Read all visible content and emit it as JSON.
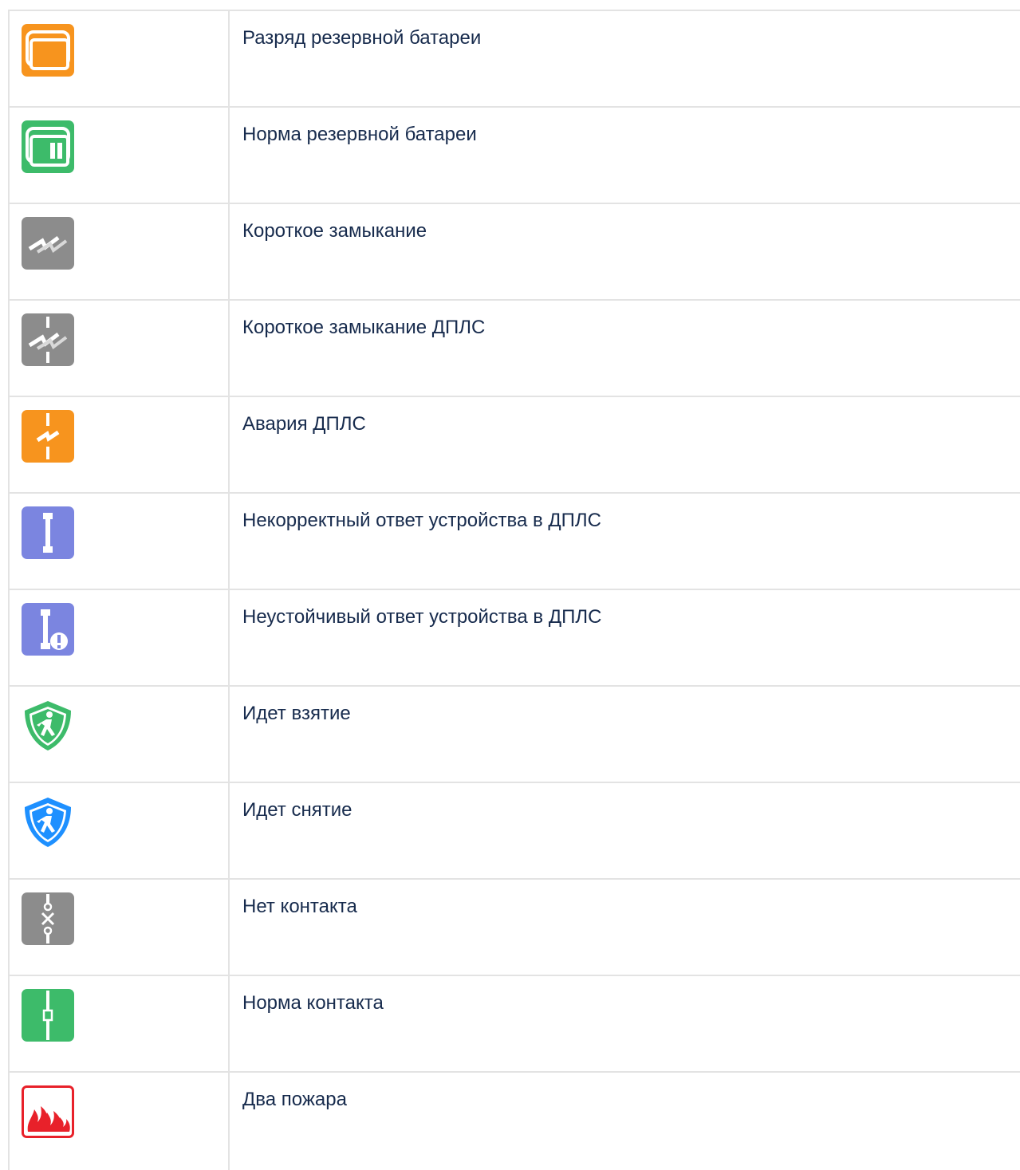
{
  "rows": [
    {
      "icon": "battery-discharge-icon",
      "label": "Разряд резервной батареи",
      "color": "#f7941e"
    },
    {
      "icon": "battery-normal-icon",
      "label": "Норма резервной батареи",
      "color": "#3dbb6a"
    },
    {
      "icon": "short-circuit-icon",
      "label": "Короткое замыкание",
      "color": "#8c8c8c"
    },
    {
      "icon": "short-circuit-dpls-icon",
      "label": "Короткое замыкание ДПЛС",
      "color": "#8c8c8c"
    },
    {
      "icon": "dpls-failure-icon",
      "label": "Авария ДПЛС",
      "color": "#f7941e"
    },
    {
      "icon": "device-invalid-response-icon",
      "label": "Некорректный ответ устройства в ДПЛС",
      "color": "#7b85e0"
    },
    {
      "icon": "device-unstable-response-icon",
      "label": "Неустойчивый ответ устройства в ДПЛС",
      "color": "#7b85e0"
    },
    {
      "icon": "arming-in-progress-icon",
      "label": "Идет взятие",
      "color": "#3dbb6a"
    },
    {
      "icon": "disarming-in-progress-icon",
      "label": "Идет снятие",
      "color": "#1e90ff"
    },
    {
      "icon": "no-contact-icon",
      "label": "Нет контакта",
      "color": "#8c8c8c"
    },
    {
      "icon": "contact-normal-icon",
      "label": "Норма контакта",
      "color": "#3dbb6a"
    },
    {
      "icon": "double-fire-icon",
      "label": "Два пожара",
      "color": "#e8212a"
    }
  ]
}
